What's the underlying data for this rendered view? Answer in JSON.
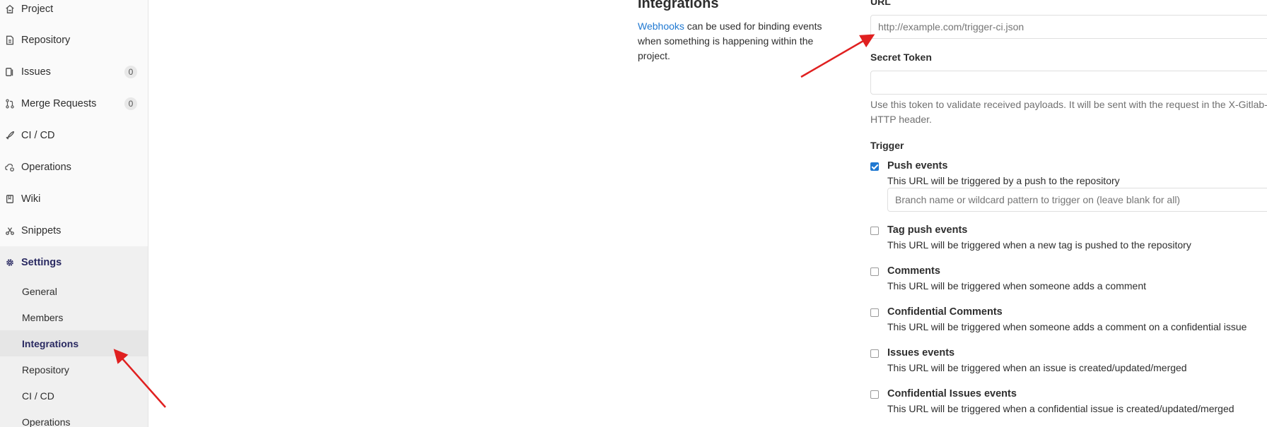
{
  "sidebar": {
    "items": [
      {
        "label": "Project",
        "icon": "project-icon",
        "count": null
      },
      {
        "label": "Repository",
        "icon": "repository-icon",
        "count": null
      },
      {
        "label": "Issues",
        "icon": "issues-icon",
        "count": "0"
      },
      {
        "label": "Merge Requests",
        "icon": "merge-request-icon",
        "count": "0"
      },
      {
        "label": "CI / CD",
        "icon": "rocket-icon",
        "count": null
      },
      {
        "label": "Operations",
        "icon": "cloud-gear-icon",
        "count": null
      },
      {
        "label": "Wiki",
        "icon": "book-icon",
        "count": null
      },
      {
        "label": "Snippets",
        "icon": "scissors-icon",
        "count": null
      },
      {
        "label": "Settings",
        "icon": "gear-icon",
        "count": null
      }
    ],
    "settings_subitems": [
      "General",
      "Members",
      "Integrations",
      "Repository",
      "CI / CD",
      "Operations"
    ],
    "active_subitem": "Integrations"
  },
  "section": {
    "title": "Integrations",
    "link_text": "Webhooks",
    "description": " can be used for binding events when something is happening within the project."
  },
  "form": {
    "url_label": "URL",
    "url_placeholder": "http://example.com/trigger-ci.json",
    "secret_label": "Secret Token",
    "secret_value": "",
    "secret_help": "Use this token to validate received payloads. It will be sent with the request in the X-Gitlab-Token HTTP header.",
    "trigger_label": "Trigger",
    "branch_placeholder": "Branch name or wildcard pattern to trigger on (leave blank for all)",
    "triggers": [
      {
        "title": "Push events",
        "desc": "This URL will be triggered by a push to the repository",
        "checked": true
      },
      {
        "title": "Tag push events",
        "desc": "This URL will be triggered when a new tag is pushed to the repository",
        "checked": false
      },
      {
        "title": "Comments",
        "desc": "This URL will be triggered when someone adds a comment",
        "checked": false
      },
      {
        "title": "Confidential Comments",
        "desc": "This URL will be triggered when someone adds a comment on a confidential issue",
        "checked": false
      },
      {
        "title": "Issues events",
        "desc": "This URL will be triggered when an issue is created/updated/merged",
        "checked": false
      },
      {
        "title": "Confidential Issues events",
        "desc": "This URL will be triggered when a confidential issue is created/updated/merged",
        "checked": false
      }
    ]
  },
  "colors": {
    "accent": "#292961",
    "link": "#1f78d1",
    "annotation_arrow": "#e02020"
  }
}
